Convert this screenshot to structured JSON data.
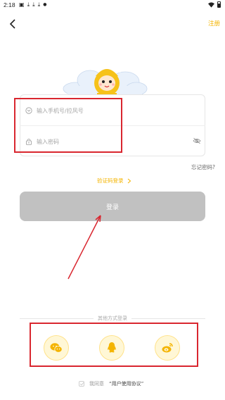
{
  "status_bar": {
    "time": "2:18",
    "icons": [
      "image-icon",
      "download-icon",
      "download-icon",
      "download-icon",
      "dot-icon"
    ],
    "right_icons": [
      "wifi-icon",
      "battery-icon"
    ]
  },
  "header": {
    "back_icon": "chevron-left-icon",
    "register_label": "注册"
  },
  "login_form": {
    "phone_placeholder": "输入手机号/拉风号",
    "password_placeholder": "输入密码",
    "phone_icon": "phone-icon",
    "lock_icon": "lock-icon",
    "eye_icon": "eye-off-icon"
  },
  "links": {
    "forgot_password": "忘记密码?",
    "code_login": "验证码登录"
  },
  "login_button": "登录",
  "other_login": {
    "label": "其他方式登录",
    "options": [
      {
        "name": "wechat",
        "icon": "wechat-icon"
      },
      {
        "name": "qq",
        "icon": "qq-icon"
      },
      {
        "name": "weibo",
        "icon": "weibo-icon"
      }
    ]
  },
  "agreement": {
    "prefix": "我同意",
    "link": "“用户使用协议”"
  },
  "colors": {
    "accent": "#f4b400",
    "button_disabled": "#c1c1c1",
    "annotation": "#d9262f",
    "icon_bg": "#fff7d6"
  }
}
